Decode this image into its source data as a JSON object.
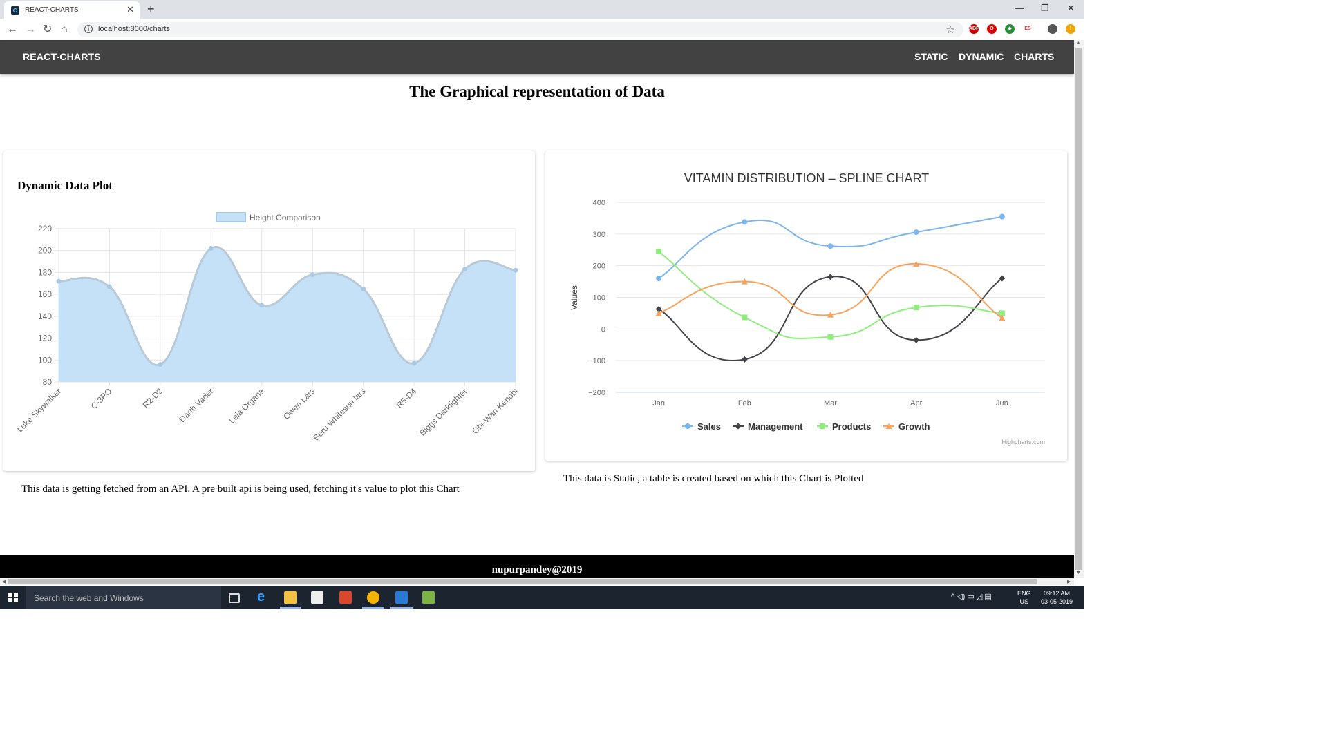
{
  "browser": {
    "tab_title": "REACT-CHARTS",
    "url": "localhost:3000/charts",
    "ext_labels": [
      "ABP",
      "ES"
    ]
  },
  "header": {
    "brand": "REACT-CHARTS",
    "nav": [
      "STATIC",
      "DYNAMIC",
      "CHARTS"
    ]
  },
  "page": {
    "title": "The Graphical representation of Data"
  },
  "left_card": {
    "heading": "Dynamic Data Plot",
    "caption": "This data is getting fetched from an API. A pre built api is being used, fetching it's value to plot this Chart"
  },
  "right_card": {
    "caption": "This data is Static, a table is created based on which this Chart is Plotted",
    "credit": "Highcharts.com"
  },
  "footer": {
    "text": "nupurpandey@2019"
  },
  "taskbar": {
    "search_placeholder": "Search the web and Windows",
    "lang": "ENG",
    "region": "US",
    "time": "09:12 AM",
    "date": "03-05-2019"
  },
  "chart_data": [
    {
      "type": "area",
      "title": "",
      "legend": [
        "Height Comparison"
      ],
      "legend_position": "top-center",
      "categories": [
        "Luke Skywalker",
        "C-3PO",
        "R2-D2",
        "Darth Vader",
        "Leia Organa",
        "Owen Lars",
        "Beru Whitesun lars",
        "R5-D4",
        "Biggs Darklighter",
        "Obi-Wan Kenobi"
      ],
      "series": [
        {
          "name": "Height Comparison",
          "values": [
            172,
            167,
            96,
            202,
            150,
            178,
            165,
            97,
            183,
            182
          ]
        }
      ],
      "ylim": [
        80,
        220
      ],
      "yticks": [
        80,
        100,
        120,
        140,
        160,
        180,
        200,
        220
      ],
      "grid": true,
      "colors": {
        "fill": "#c5e1f7",
        "line": "#b9c9d6",
        "point": "#a9c8e3"
      }
    },
    {
      "type": "line",
      "title": "VITAMIN DISTRIBUTION – SPLINE CHART",
      "ylabel": "Values",
      "categories": [
        "Jan",
        "Feb",
        "Mar",
        "Apr",
        "Jun"
      ],
      "series": [
        {
          "name": "Sales",
          "values": [
            160,
            338,
            262,
            306,
            355
          ],
          "color": "#7cb5ec",
          "marker": "circle"
        },
        {
          "name": "Management",
          "values": [
            63,
            -96,
            165,
            -35,
            160
          ],
          "color": "#434348",
          "marker": "diamond"
        },
        {
          "name": "Products",
          "values": [
            245,
            37,
            -25,
            68,
            50
          ],
          "color": "#90ed7d",
          "marker": "square"
        },
        {
          "name": "Growth",
          "values": [
            50,
            150,
            45,
            206,
            35
          ],
          "color": "#f7a35c",
          "marker": "triangle"
        }
      ],
      "ylim": [
        -200,
        400
      ],
      "yticks": [
        -200,
        -100,
        0,
        100,
        200,
        300,
        400
      ],
      "grid": true,
      "legend_position": "bottom-center"
    }
  ]
}
